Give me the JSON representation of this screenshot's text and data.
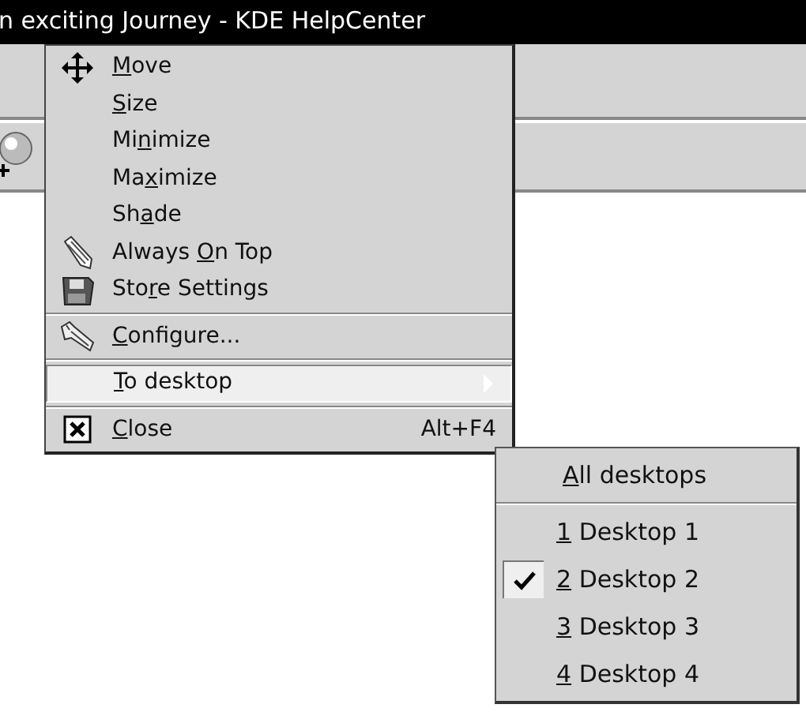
{
  "window": {
    "title": "n exciting Journey - KDE HelpCenter"
  },
  "window_menu": {
    "groups": [
      [
        {
          "key": "M",
          "post": "ove",
          "selected": false
        },
        {
          "key": "S",
          "post": "ize",
          "selected": false
        },
        {
          "pre": "Mi",
          "key": "n",
          "post": "imize",
          "selected": false
        },
        {
          "pre": "Ma",
          "key": "x",
          "post": "imize",
          "selected": false
        },
        {
          "pre": "Sh",
          "key": "a",
          "post": "de",
          "selected": false
        },
        {
          "pre": "Always ",
          "key": "O",
          "post": "n Top",
          "selected": false
        },
        {
          "pre": "Sto",
          "key": "r",
          "post": "e Settings",
          "selected": false
        }
      ],
      [
        {
          "key": "C",
          "post": "onfigure...",
          "selected": false
        }
      ],
      [
        {
          "key": "T",
          "post": "o desktop",
          "selected": true,
          "has_submenu": true
        }
      ],
      [
        {
          "key": "C",
          "post": "lose",
          "selected": false,
          "shortcut": "Alt+F4"
        }
      ]
    ]
  },
  "desktop_submenu": {
    "all": {
      "key": "A",
      "post": "ll desktops"
    },
    "items": [
      {
        "key": "1",
        "post": " Desktop 1",
        "checked": false
      },
      {
        "key": "2",
        "post": " Desktop 2",
        "checked": true
      },
      {
        "key": "3",
        "post": " Desktop 3",
        "checked": false
      },
      {
        "key": "4",
        "post": " Desktop 4",
        "checked": false
      }
    ]
  }
}
